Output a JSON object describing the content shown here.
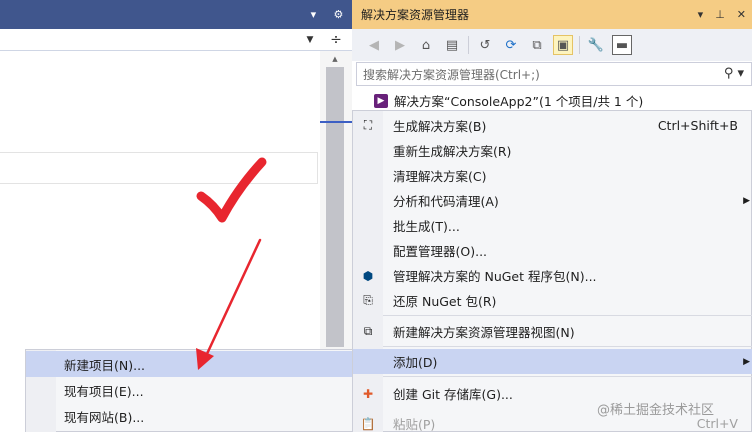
{
  "solution_explorer": {
    "title": "解决方案资源管理器",
    "search_placeholder": "搜索解决方案资源管理器(Ctrl+;)",
    "root_item": "解决方案“ConsoleApp2”(1 个项目/共 1 个)"
  },
  "context_menu": {
    "items": [
      {
        "label": "生成解决方案(B)",
        "shortcut": "Ctrl+Shift+B"
      },
      {
        "label": "重新生成解决方案(R)",
        "shortcut": ""
      },
      {
        "label": "清理解决方案(C)",
        "shortcut": ""
      },
      {
        "label": "分析和代码清理(A)",
        "shortcut": ""
      },
      {
        "label": "批生成(T)...",
        "shortcut": ""
      },
      {
        "label": "配置管理器(O)...",
        "shortcut": ""
      },
      {
        "label": "管理解决方案的 NuGet 程序包(N)...",
        "shortcut": ""
      },
      {
        "label": "还原 NuGet 包(R)",
        "shortcut": ""
      },
      {
        "label": "新建解决方案资源管理器视图(N)",
        "shortcut": ""
      },
      {
        "label": "添加(D)",
        "shortcut": ""
      },
      {
        "label": "创建 Git 存储库(G)...",
        "shortcut": ""
      },
      {
        "label": "粘贴(P)",
        "shortcut": "Ctrl+V"
      }
    ]
  },
  "submenu": {
    "items": [
      {
        "label": "新建项目(N)..."
      },
      {
        "label": "现有项目(E)..."
      },
      {
        "label": "现有网站(B)..."
      }
    ]
  },
  "watermark": "@稀土掘金技术社区",
  "colors": {
    "left_header": "#40568d",
    "se_title_bg": "#f5cc84",
    "highlight": "#c9d4f2",
    "annotation_red": "#e8262f"
  }
}
